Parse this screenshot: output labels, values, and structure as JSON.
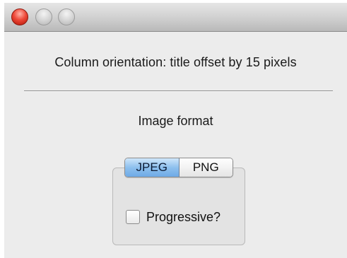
{
  "window": {
    "controls": {
      "close_icon": "close-icon",
      "minimize_icon": "minimize-icon",
      "zoom_icon": "zoom-icon"
    }
  },
  "heading": "Column orientation: title offset by 15 pixels",
  "image_format": {
    "label": "Image format",
    "options": [
      {
        "label": "JPEG",
        "selected": true
      },
      {
        "label": "PNG",
        "selected": false
      }
    ],
    "progressive_checkbox": {
      "label": "Progressive?",
      "checked": false
    }
  },
  "colors": {
    "selected_segment": "#8ec0ee",
    "close_button": "#ee4a3a",
    "window_background": "#ececec"
  }
}
